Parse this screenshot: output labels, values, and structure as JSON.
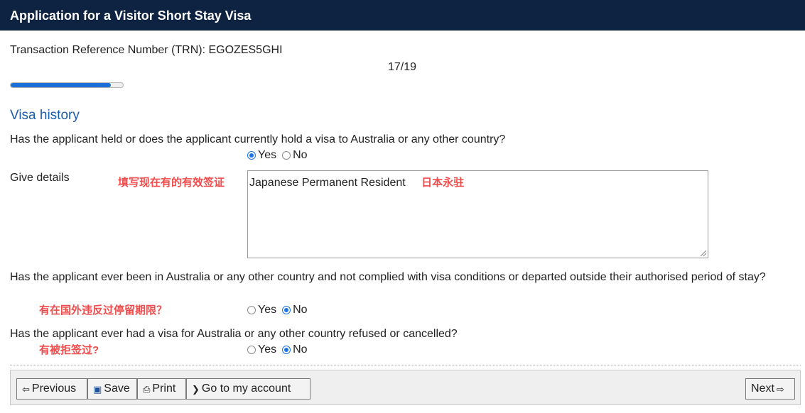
{
  "header": {
    "title": "Application for a Visitor Short Stay Visa"
  },
  "trn": {
    "label": "Transaction Reference Number (TRN): EGOZES5GHI"
  },
  "pager": {
    "text": "17/19"
  },
  "progress": {
    "fraction": 0.895
  },
  "section": {
    "title": "Visa history"
  },
  "q1": {
    "text": "Has the applicant held or does the applicant currently hold a visa to Australia or any other country?",
    "yes_label": "Yes",
    "no_label": "No",
    "selected": "Yes"
  },
  "details": {
    "label": "Give details",
    "annotation": "填写现在有的有效签证",
    "value": "Japanese Permanent Resident",
    "value_annotation": "日本永驻"
  },
  "q2": {
    "text": "Has the applicant ever been in Australia or any other country and not complied with visa conditions or departed outside their authorised period of stay?",
    "annotation": "有在国外违反过停留期限？",
    "yes_label": "Yes",
    "no_label": "No",
    "selected": "No"
  },
  "q3": {
    "text": "Has the applicant ever had a visa for Australia or any other country refused or cancelled?",
    "annotation": "有被拒签过?",
    "yes_label": "Yes",
    "no_label": "No",
    "selected": "No"
  },
  "footer": {
    "previous_label": "Previous",
    "previous_icon": "arrow-left-icon",
    "save_label": "Save",
    "save_icon": "floppy-disk-icon",
    "print_label": "Print",
    "print_icon": "printer-icon",
    "account_label": "Go to my account",
    "account_icon": "chevron-right-icon",
    "next_label": "Next",
    "next_icon": "arrow-right-icon"
  }
}
